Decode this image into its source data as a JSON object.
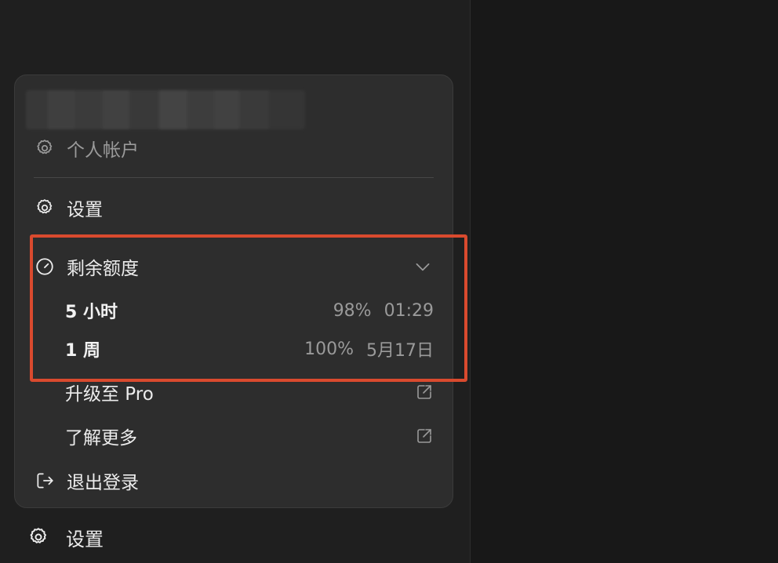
{
  "menu": {
    "account": {
      "label": "个人帐户",
      "icon": "gear-icon"
    },
    "settings": {
      "label": "设置",
      "icon": "gear-icon"
    },
    "quota": {
      "label": "剩余额度",
      "icon": "gauge-icon",
      "expanded": true,
      "rows": [
        {
          "label": "5 小时",
          "percent": "98%",
          "reset": "01:29"
        },
        {
          "label": "1 周",
          "percent": "100%",
          "reset": "5月17日"
        }
      ]
    },
    "upgrade": {
      "label": "升级至 Pro",
      "icon": "external-link-icon"
    },
    "learn_more": {
      "label": "了解更多",
      "icon": "external-link-icon"
    },
    "logout": {
      "label": "退出登录",
      "icon": "logout-icon"
    }
  },
  "sidebar": {
    "settings_label": "设置"
  },
  "colors": {
    "highlight": "#d94a2e",
    "menu_bg": "#2d2d2d",
    "text_primary": "#ececec",
    "text_muted": "#9a9a9a"
  }
}
